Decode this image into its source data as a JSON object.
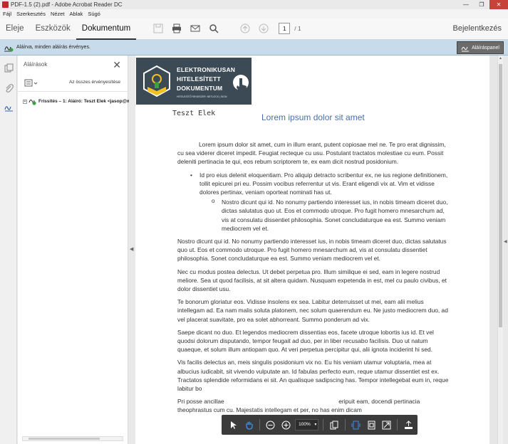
{
  "window": {
    "title": "PDF-1.5 (2).pdf - Adobe Acrobat Reader DC",
    "minimize": "—",
    "maximize": "❐",
    "close": "✕"
  },
  "menu": [
    "Fájl",
    "Szerkesztés",
    "Nézet",
    "Ablak",
    "Súgó"
  ],
  "toolbar": {
    "tabs": [
      "Eleje",
      "Eszközök",
      "Dokumentum"
    ],
    "page_current": "1",
    "page_total": "/ 1",
    "login": "Bejelentkezés"
  },
  "sigbar": {
    "text": "Aláírva, minden aláírás érvényes.",
    "panel_button": "Aláíráspanel"
  },
  "sig_panel": {
    "title": "Aláírások",
    "validate_all": "Az összes érvényesítése",
    "entry": "Frissítés – 1: Aláíró: Teszt Elek <jasop@m"
  },
  "logo": {
    "lines": [
      "ELEKTRONIKUSAN",
      "HITELESÍTETT",
      "DOKUMENTUM"
    ],
    "sub": "HITELESÍTŐ RENDSZER: NETLOCK | SIGN"
  },
  "document": {
    "signer": "Teszt Elek",
    "title": "Lorem ipsum dolor sit amet",
    "p1": "Lorem ipsum dolor sit amet, cum in illum erant, putent copiosae mel ne. Te pro erat dignissim, cu sea viderer diceret impedit. Feugiat recteque cu usu. Postulant tractatos molestiae cu eum. Possit deleniti pertinacia te qui, eos rebum scriptorem te, ex eam dicit nostrud posidonium.",
    "bullet1": "Id pro eius delenit eloquentiam. Pro aliquip detracto scribentur ex, ne ius regione definitionem, tollit epicurei pri eu. Possim vocibus referrentur ut vis. Erant eligendi vix at. Vim et vidisse dolores pertinax, veniam oporteat nominati has ut.",
    "bullet2": "Nostro dicunt qui id. No nonumy partiendo interesset ius, in nobis timeam diceret duo, dictas salutatus quo ut. Eos et commodo utroque. Pro fugit homero mnesarchum ad, vis at consulatu dissentiet philosophia. Sonet concludaturque ea est. Summo veniam mediocrem vel et.",
    "p2": "Nostro dicunt qui id. No nonumy partiendo interesset ius, in nobis timeam diceret duo, dictas salutatus quo ut. Eos et commodo utroque. Pro fugit homero mnesarchum ad, vis at consulatu dissentiet philosophia. Sonet concludaturque ea est. Summo veniam mediocrem vel et.",
    "p3": "Nec cu modus postea delectus. Ut debet perpetua pro. Illum similique ei sed, eam in legere nostrud meliore. Sea ut quod facilisis, at sit altera quidam. Nusquam expetenda in est, mel cu paulo civibus, et dolor dissentiet usu.",
    "p4": "Te bonorum gloriatur eos. Vidisse insolens ex sea. Labitur deterruisset ut mei, eam alii melius intellegam ad. Ea nam malis soluta platonem, nec solum quaerendum eu. Ne justo mediocrem duo, ad vel placerat suavitate, pro ea solet abhorreant. Summo ponderum ad vix.",
    "p5": "Saepe dicant no duo. Et legendos mediocrem dissentias eos, facete utroque lobortis ius id. Et vel quodsi dolorum disputando, tempor feugait ad duo, per in liber recusabo facilisis. Duo ut natum quaeque, et solum illum antiopam quo. At veri perpetua percipitur qui, alii ignota inciderint hi sed.",
    "p6": "Vis facilis delectus an, meis singulis posidonium vix no. Eu his veniam utamur voluptaria, mea at albucius iudicabit, sit vivendo vulputate an. Id fabulas perfecto eum, reque utamur dissentiet est ex. Tractatos splendide reformidans ei sit. An qualisque sadipscing has. Tempor intellegebat eum in, reque labitur bo",
    "p7": "Pri posse ancillae                                                                     eripuit eam, docendi pertinacia theophrastus cum cu. Majestatis intellegam et per, no has enim dicam"
  },
  "floatbar": {
    "zoom": "100%"
  }
}
